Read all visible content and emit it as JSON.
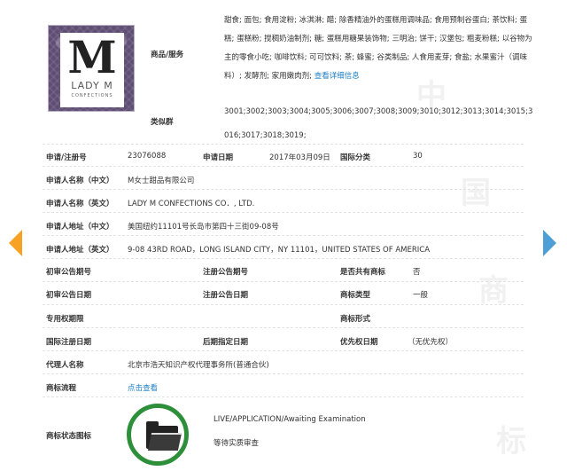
{
  "logo": {
    "letter": "M",
    "word": "LADY M",
    "sub": "CONFECTIONS"
  },
  "fields": {
    "goods_label": "商品/服务",
    "class_group_label": "类似群",
    "goods_text": "甜食; 面包; 食用淀粉; 冰淇淋; 醋; 除香精油外的蛋糕用调味品; 食用预制谷蛋白; 茶饮料; 蛋糕; 蛋糕粉; 搅稠奶油制剂; 糖; 蛋糕用糖果装饰物; 三明治; 饼干; 汉堡包; 粗麦粉糕; 以谷物为主的零食小吃; 咖啡饮料; 可可饮料; 茶; 蜂蜜; 谷类制品; 人食用麦芽; 食盐; 水果蜜汁（调味料）; 发酵剂; 家用嫩肉剂;",
    "goods_more_link": "查看详细信息",
    "class_groups": "3001;3002;3003;3004;3005;3006;3007;3008;3009;3010;3012;3013;3014;3015;3016;3017;3018;3019;",
    "reg_no_label": "申请/注册号",
    "reg_no": "23076088",
    "apply_date_label": "申请日期",
    "apply_date": "2017年03月09日",
    "intl_class_label": "国际分类",
    "intl_class": "30",
    "applicant_cn_label": "申请人名称（中文）",
    "applicant_cn": "M女士甜品有限公司",
    "applicant_en_label": "申请人名称（英文）",
    "applicant_en": "LADY M CONFECTIONS CO．, LTD.",
    "address_cn_label": "申请人地址（中文）",
    "address_cn": "美国纽约11101号长岛市第四十三街09-08号",
    "address_en_label": "申请人地址（英文）",
    "address_en": "9-08 43RD ROAD，LONG ISLAND CITY，NY 11101，UNITED STATES OF AMERICA",
    "prelim_pub_no_label": "初审公告期号",
    "reg_pub_no_label": "注册公告期号",
    "shared_label": "是否共有商标",
    "shared_value": "否",
    "prelim_pub_date_label": "初审公告日期",
    "reg_pub_date_label": "注册公告日期",
    "mark_type_label": "商标类型",
    "mark_type": "一般",
    "exclusive_period_label": "专用权期限",
    "mark_form_label": "商标形式",
    "intl_reg_date_label": "国际注册日期",
    "later_date_label": "后期指定日期",
    "priority_date_label": "优先权日期",
    "priority_date": "（无优先权）",
    "agent_label": "代理人名称",
    "agent": "北京市浩天知识产权代理事务所(普通合伙)",
    "process_label": "商标流程",
    "process_link": "点击查看",
    "status_icon_label": "商标状态图标",
    "status_en": "LIVE/APPLICATION/Awaiting Examination",
    "status_cn": "等待实质审查"
  },
  "watermark": [
    "中",
    "国",
    "商",
    "标"
  ],
  "colors": {
    "link": "#1a7fc4",
    "arrow_left": "#f7a125",
    "arrow_right": "#4d9fd6",
    "status_ring": "#2d8f3a"
  }
}
